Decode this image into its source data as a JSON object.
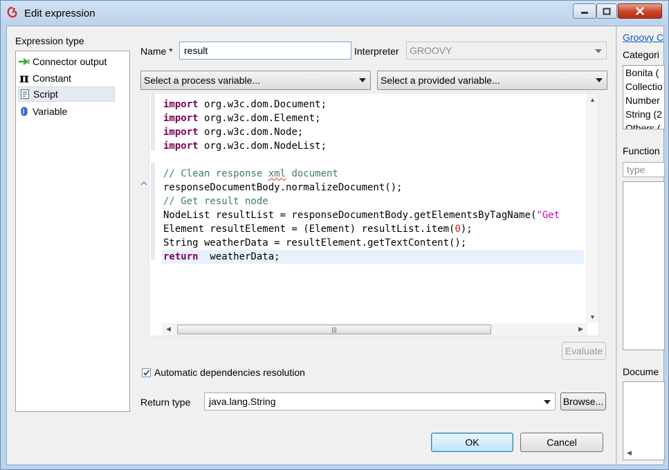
{
  "window": {
    "title": "Edit expression",
    "accent": "#bcd3ec",
    "close_color": "#c8442a"
  },
  "expression_type": {
    "label": "Expression type",
    "items": [
      {
        "label": "Connector output",
        "icon": "connector-arrow-icon"
      },
      {
        "label": "Constant",
        "icon": "pi-icon"
      },
      {
        "label": "Script",
        "icon": "script-icon",
        "selected": true
      },
      {
        "label": "Variable",
        "icon": "variable-cylinder-icon"
      }
    ]
  },
  "form": {
    "name_label": "Name *",
    "name_value": "result",
    "interpreter_label": "Interpreter",
    "interpreter_value": "GROOVY",
    "process_variable_placeholder": "Select a process variable...",
    "provided_variable_placeholder": "Select a provided variable..."
  },
  "editor": {
    "lines": [
      [
        {
          "t": "import",
          "c": "kw"
        },
        {
          "t": " org.w3c.dom.Document;"
        }
      ],
      [
        {
          "t": "import",
          "c": "kw"
        },
        {
          "t": " org.w3c.dom.Element;"
        }
      ],
      [
        {
          "t": "import",
          "c": "kw"
        },
        {
          "t": " org.w3c.dom.Node;"
        }
      ],
      [
        {
          "t": "import",
          "c": "kw"
        },
        {
          "t": " org.w3c.dom.NodeList;"
        }
      ],
      [
        {
          "t": ""
        }
      ],
      [
        {
          "t": "// Clean response ",
          "c": "cm"
        },
        {
          "t": "xml",
          "c": "cm squig"
        },
        {
          "t": " document",
          "c": "cm"
        }
      ],
      [
        {
          "t": "responseDocumentBody.normalizeDocument();"
        }
      ],
      [
        {
          "t": "// Get result node",
          "c": "cm"
        }
      ],
      [
        {
          "t": "NodeList resultList = responseDocumentBody.getElementsByTagName("
        },
        {
          "t": "\"Get",
          "c": "str"
        }
      ],
      [
        {
          "t": "Element resultElement = (Element) resultList.item("
        },
        {
          "t": "0",
          "c": "num"
        },
        {
          "t": ");"
        }
      ],
      [
        {
          "t": "String weatherData = resultElement.getTextContent();"
        }
      ],
      [
        {
          "t": "return",
          "c": "kw"
        },
        {
          "t": "  weatherData;"
        }
      ]
    ],
    "current_line": 11
  },
  "buttons": {
    "evaluate": "Evaluate",
    "browse": "Browse...",
    "ok": "OK",
    "cancel": "Cancel"
  },
  "auto_dependencies": {
    "label": "Automatic dependencies resolution",
    "checked": true
  },
  "return_type": {
    "label": "Return type",
    "value": "java.lang.String"
  },
  "right_panel": {
    "link": "Groovy C",
    "categories_label": "Categori",
    "categories": [
      "Bonita (",
      "Collectio",
      "Number",
      "String (2",
      "Others ("
    ],
    "functions_label": "Function",
    "functions_placeholder": "type",
    "documentation_label": "Docume"
  }
}
